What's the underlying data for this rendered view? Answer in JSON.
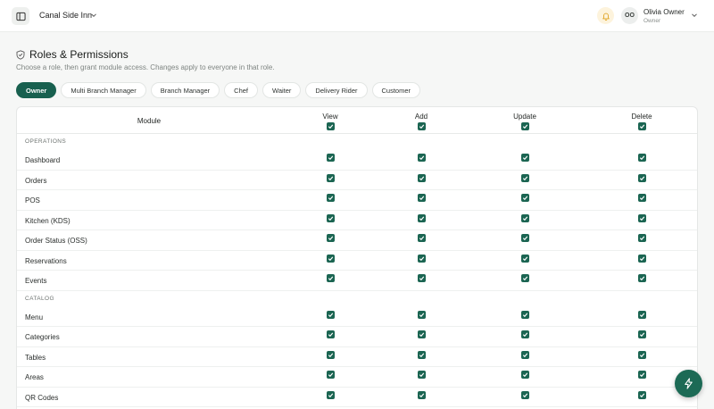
{
  "topbar": {
    "store_name": "Canal Side Inn",
    "user_initials": "OO",
    "user_name": "Olivia Owner",
    "user_role": "Owner"
  },
  "page": {
    "title": "Roles & Permissions",
    "subtitle": "Choose a role, then grant module access. Changes apply to everyone in that role."
  },
  "roles": [
    "Owner",
    "Multi Branch Manager",
    "Branch Manager",
    "Chef",
    "Waiter",
    "Delivery Rider",
    "Customer"
  ],
  "active_role": "Owner",
  "table": {
    "module_header": "Module",
    "permissions": [
      "View",
      "Add",
      "Update",
      "Delete"
    ],
    "header_checked": [
      true,
      true,
      true,
      true
    ],
    "sections": [
      {
        "title": "OPERATIONS",
        "modules": [
          {
            "name": "Dashboard",
            "checked": [
              true,
              true,
              true,
              true
            ]
          },
          {
            "name": "Orders",
            "checked": [
              true,
              true,
              true,
              true
            ]
          },
          {
            "name": "POS",
            "checked": [
              true,
              true,
              true,
              true
            ]
          },
          {
            "name": "Kitchen (KDS)",
            "checked": [
              true,
              true,
              true,
              true
            ]
          },
          {
            "name": "Order Status (OSS)",
            "checked": [
              true,
              true,
              true,
              true
            ]
          },
          {
            "name": "Reservations",
            "checked": [
              true,
              true,
              true,
              true
            ]
          },
          {
            "name": "Events",
            "checked": [
              true,
              true,
              true,
              true
            ]
          }
        ]
      },
      {
        "title": "CATALOG",
        "modules": [
          {
            "name": "Menu",
            "checked": [
              true,
              true,
              true,
              true
            ]
          },
          {
            "name": "Categories",
            "checked": [
              true,
              true,
              true,
              true
            ]
          },
          {
            "name": "Tables",
            "checked": [
              true,
              true,
              true,
              true
            ]
          },
          {
            "name": "Areas",
            "checked": [
              true,
              true,
              true,
              true
            ]
          },
          {
            "name": "QR Codes",
            "checked": [
              true,
              true,
              true,
              true
            ]
          }
        ]
      }
    ]
  },
  "colors": {
    "accent": "#18604f",
    "checkbox": "#1b6552",
    "bell_bg": "#fdf3dc",
    "bell_icon": "#e0a526"
  },
  "icons": {
    "sidebar_toggle": "sidebar-panel-icon",
    "store_chevron": "chevron-down-icon",
    "bell": "bell-icon",
    "user_chevron": "chevron-down-icon",
    "title_icon": "shield-check-icon",
    "fab": "lightning-bolt-icon"
  }
}
